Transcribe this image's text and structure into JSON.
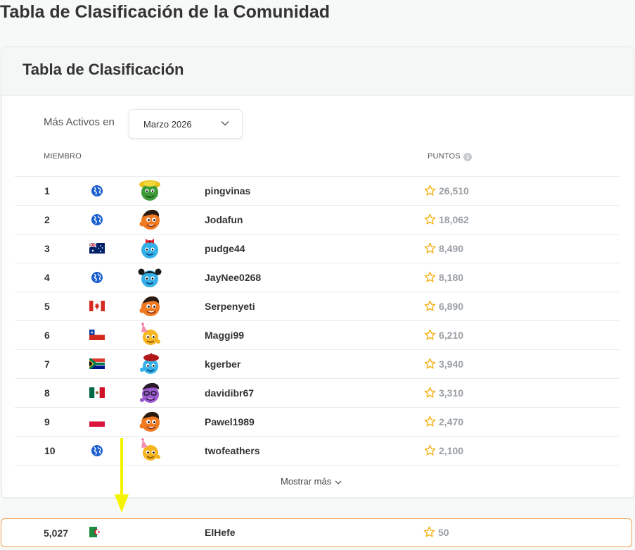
{
  "page": {
    "title": "Tabla de Clasificación de la Comunidad"
  },
  "card": {
    "title": "Tabla de Clasificación",
    "filter_label": "Más Activos en",
    "month_selected": "Marzo 2026",
    "col_member": "MIEMBRO",
    "col_points": "PUNTOS",
    "show_more": "Mostrar más"
  },
  "rows": [
    {
      "rank": "1",
      "region": "globe-icon",
      "avatar": "green-hat-avatar",
      "name": "pingvinas",
      "points": "26,510"
    },
    {
      "rank": "2",
      "region": "globe-icon",
      "avatar": "orange-avatar",
      "name": "Jodafun",
      "points": "18,062"
    },
    {
      "rank": "3",
      "region": "australia-flag",
      "avatar": "blue-bow-avatar",
      "name": "pudge44",
      "points": "8,490"
    },
    {
      "rank": "4",
      "region": "globe-icon",
      "avatar": "blue-pigtails-avatar",
      "name": "JayNee0268",
      "points": "8,180"
    },
    {
      "rank": "5",
      "region": "canada-flag",
      "avatar": "orange-avatar",
      "name": "Serpenyeti",
      "points": "6,890"
    },
    {
      "rank": "6",
      "region": "chile-flag",
      "avatar": "party-hat-avatar",
      "name": "Maggi99",
      "points": "6,210"
    },
    {
      "rank": "7",
      "region": "south-africa-flag",
      "avatar": "beret-avatar",
      "name": "kgerber",
      "points": "3,940"
    },
    {
      "rank": "8",
      "region": "mexico-flag",
      "avatar": "purple-avatar",
      "name": "davidibr67",
      "points": "3,310"
    },
    {
      "rank": "9",
      "region": "poland-flag",
      "avatar": "orange-avatar",
      "name": "Pawel1989",
      "points": "2,470"
    },
    {
      "rank": "10",
      "region": "globe-icon",
      "avatar": "party-hat-avatar",
      "name": "twofeathers",
      "points": "2,100"
    }
  ],
  "current_user": {
    "rank": "5,027",
    "region": "algeria-flag",
    "name": "ElHefe",
    "points": "50"
  },
  "colors": {
    "star": "#f5b21a",
    "highlight_border": "#f0a050",
    "arrow": "#f4f400",
    "globe": "#1b5fcf"
  }
}
